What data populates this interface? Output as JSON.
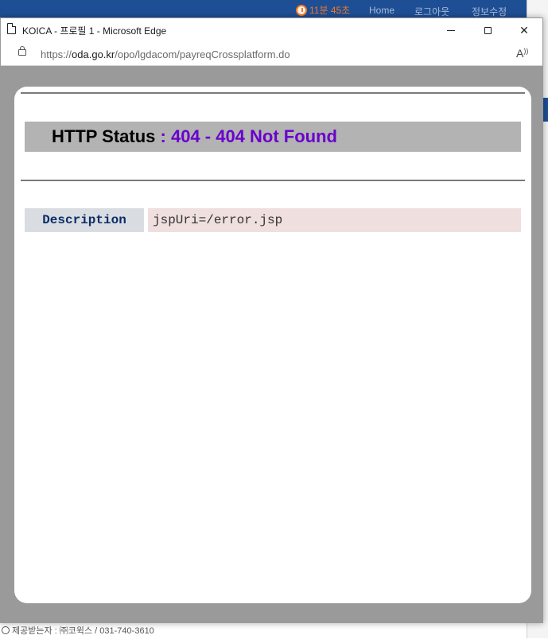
{
  "background": {
    "timer": "11분 45초",
    "links": [
      "Home",
      "로그아웃",
      "정보수정"
    ],
    "footer": "제공받는자 : ㈜코윅스 / 031-740-3610"
  },
  "window": {
    "title": "KOICA - 프로필 1 - Microsoft Edge",
    "url_scheme": "https://",
    "url_domain": "oda.go.kr",
    "url_path": "/opo/lgdacom/payreqCrossplatform.do"
  },
  "error_page": {
    "heading_prefix": "HTTP Status",
    "heading_code": ": 404 - 404 Not Found",
    "description_label": "Description",
    "description_value": "jspUri=/error.jsp"
  },
  "colors": {
    "heading_accent": "#6a00cc",
    "label_text": "#0c2c66",
    "value_bg": "#f0dfdf"
  }
}
